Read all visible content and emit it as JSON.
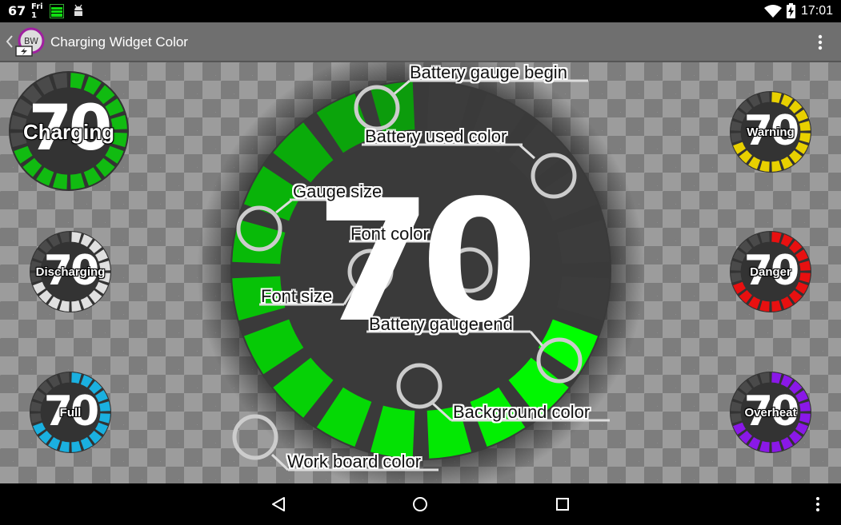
{
  "status_bar": {
    "temperature": "67",
    "day_name": "Fri",
    "day_number": "1",
    "time": "17:01"
  },
  "app": {
    "icon_text": "BW",
    "title": "Charging Widget Color"
  },
  "main_gauge": {
    "value": "70",
    "level_percent": 70,
    "used_color": "#3c3c3c",
    "fill_color_begin": "#0c9c0c",
    "fill_color_end": "#00ff00"
  },
  "callouts": {
    "battery_gauge_begin": "Battery gauge begin",
    "battery_used_color": "Battery used color",
    "gauge_size": "Gauge size",
    "font_color": "Font color",
    "font_size": "Font size",
    "battery_gauge_end": "Battery gauge end",
    "background_color": "Background color",
    "work_board_color": "Work board color"
  },
  "preview_gauges": [
    {
      "id": "charging",
      "label": "Charging",
      "value": "70",
      "color": "#11bb11"
    },
    {
      "id": "discharging",
      "label": "Discharging",
      "value": "70",
      "color": "#e0e0e0"
    },
    {
      "id": "full",
      "label": "Full",
      "value": "70",
      "color": "#1ab0e0"
    },
    {
      "id": "warning",
      "label": "Warning",
      "value": "70",
      "color": "#e8d000"
    },
    {
      "id": "danger",
      "label": "Danger",
      "value": "70",
      "color": "#e81010"
    },
    {
      "id": "overheat",
      "label": "Overheat",
      "value": "70",
      "color": "#8a18e8"
    }
  ]
}
